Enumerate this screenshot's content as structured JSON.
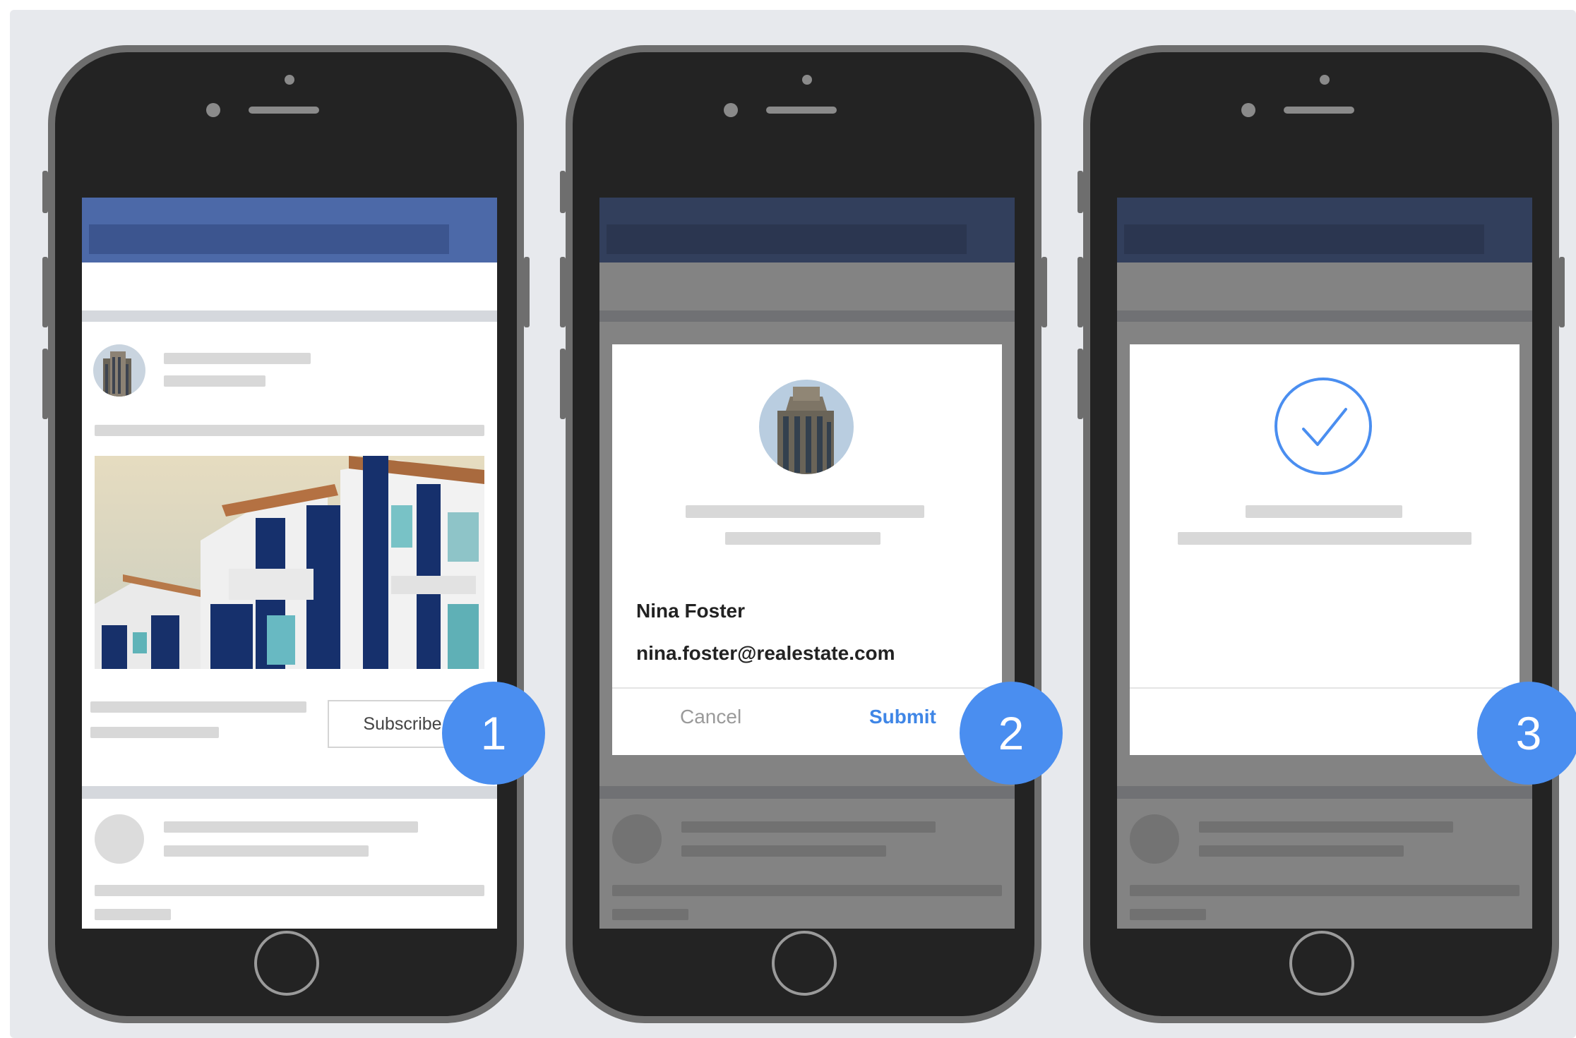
{
  "steps": [
    {
      "number": "1"
    },
    {
      "number": "2"
    },
    {
      "number": "3"
    }
  ],
  "feed": {
    "subscribe_label": "Subscribe"
  },
  "form_dialog": {
    "name": "Nina Foster",
    "email": "nina.foster@realestate.com",
    "cancel_label": "Cancel",
    "submit_label": "Submit"
  },
  "icons": {
    "success": "checkmark-circle-icon",
    "avatar": "building-avatar",
    "post_image": "building-photo"
  },
  "colors": {
    "header_blue": "#4c69a8",
    "badge_blue": "#4a8ef0",
    "submit_blue": "#3f86e6",
    "check_blue": "#4a8ef0",
    "phone_body": "#232323",
    "phone_rim": "#6e6e6e",
    "background": "#e7e9ed"
  }
}
